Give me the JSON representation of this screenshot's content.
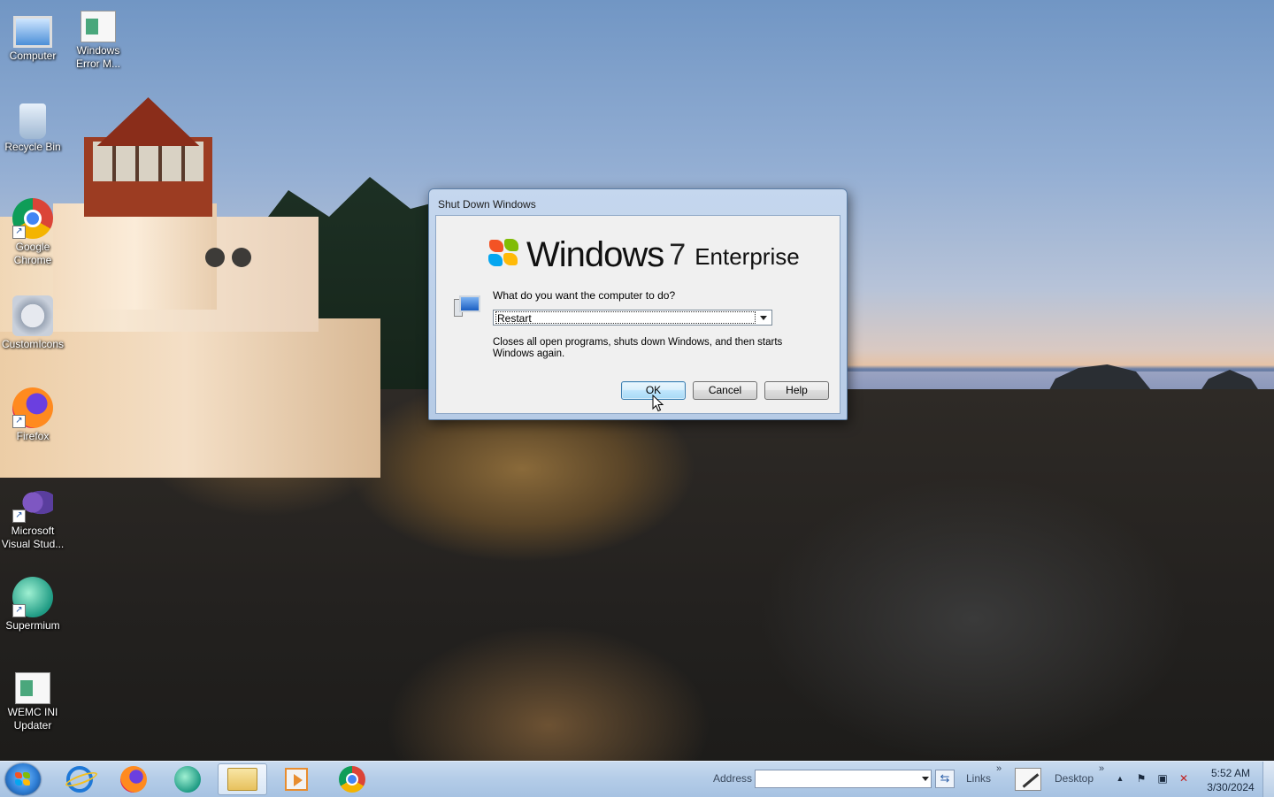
{
  "desktop": {
    "icons": [
      {
        "label": "Computer",
        "icon": "computer-icon"
      },
      {
        "label": "Windows Error M...",
        "icon": "document-icon"
      },
      {
        "label": "Recycle Bin",
        "icon": "recycle-bin-icon"
      },
      {
        "label": "Google Chrome",
        "icon": "chrome-icon"
      },
      {
        "label": "CustomIcons",
        "icon": "settings-file-icon"
      },
      {
        "label": "Firefox",
        "icon": "firefox-icon"
      },
      {
        "label": "Microsoft Visual Stud...",
        "icon": "visual-studio-icon"
      },
      {
        "label": "Supermium",
        "icon": "supermium-icon"
      },
      {
        "label": "WEMC INI Updater",
        "icon": "document-icon"
      }
    ]
  },
  "dialog": {
    "title": "Shut Down Windows",
    "brand": {
      "windows": "Windows",
      "version": "7",
      "edition": "Enterprise"
    },
    "question": "What do you want the computer to do?",
    "selected_action": "Restart",
    "description": "Closes all open programs, shuts down Windows, and then starts Windows again.",
    "buttons": {
      "ok": "OK",
      "cancel": "Cancel",
      "help": "Help"
    }
  },
  "taskbar": {
    "pinned": [
      {
        "name": "internet-explorer-icon"
      },
      {
        "name": "firefox-icon"
      },
      {
        "name": "supermium-icon"
      },
      {
        "name": "explorer-folder-icon",
        "active": true
      },
      {
        "name": "media-player-icon"
      },
      {
        "name": "chrome-icon"
      }
    ],
    "address_label": "Address",
    "address_value": "",
    "links_label": "Links",
    "desktop_label": "Desktop",
    "clock_time": "5:52 AM",
    "clock_date": "3/30/2024"
  },
  "colors": {
    "taskbar": "#b5cde8",
    "dialog_frame": "#c5d7ee",
    "default_button": "#bee6fd"
  }
}
